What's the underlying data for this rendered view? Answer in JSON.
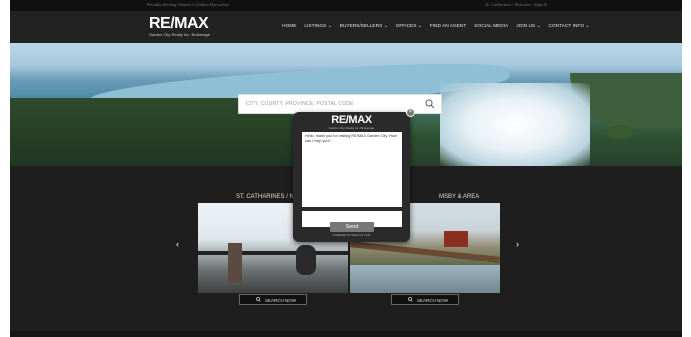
{
  "top_bar": {
    "tagline": "Proudly Serving Ontario's Golden Horseshoe",
    "utility_links": [
      "St. Catharines",
      "Welcome",
      "Sign In"
    ]
  },
  "brand": {
    "logo": "RE/MAX",
    "sub": "Garden City Realty Inc. Brokerage"
  },
  "nav": [
    {
      "label": "HOME"
    },
    {
      "label": "LISTINGS ⌄"
    },
    {
      "label": "BUYERS/SELLERS ⌄"
    },
    {
      "label": "OFFICES ⌄"
    },
    {
      "label": "FIND AN AGENT"
    },
    {
      "label": "SOCIAL MEDIA"
    },
    {
      "label": "JOIN US ⌄"
    },
    {
      "label": "CONTACT INFO ⌄"
    }
  ],
  "search": {
    "placeholder": "CITY, COUNTY, PROVINCE, POSTAL CODE"
  },
  "listings": {
    "left_title": "ST. CATHARINES / NIA",
    "right_title": "MSBY & AREA",
    "prev_arrow": "‹",
    "next_arrow": "›",
    "search_now_label": "SEARCH NOW"
  },
  "chat": {
    "logo": "RE/MAX",
    "sub": "Garden City Realty Inc. Brokerage",
    "message": "Hello, thank you for visiting RE/MAX Garden City. How can I help you?",
    "send_label": "Send",
    "powered_by": "POWERED BY REALTOR.COM",
    "close_label": "×"
  }
}
